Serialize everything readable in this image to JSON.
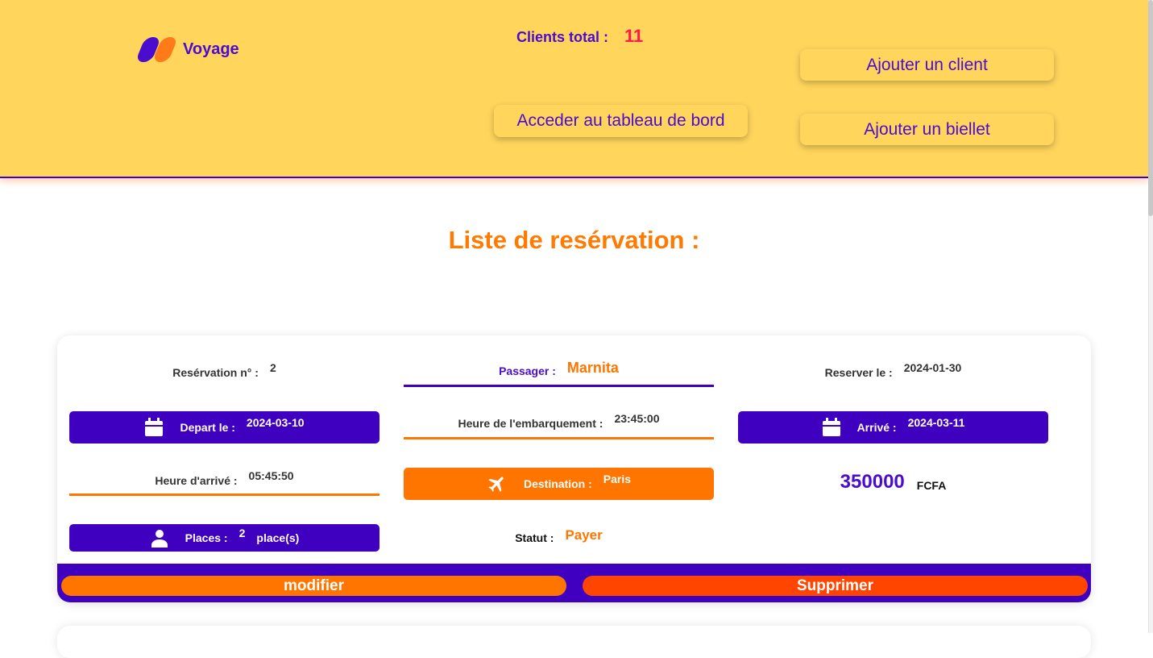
{
  "header": {
    "logo_text": "Voyage",
    "clients_label": "Clients total :",
    "clients_count": "11",
    "add_client_label": "Ajouter un client",
    "dashboard_label": "Acceder au tableau de bord",
    "add_ticket_label": "Ajouter un biellet"
  },
  "page_title": "Liste de resérvation :",
  "reservation": {
    "number_label": "Resérvation n° :",
    "number": "2",
    "passenger_label": "Passager :",
    "passenger": "Marnita",
    "booked_label": "Reserver le :",
    "booked_date": "2024-01-30",
    "departure_label": "Depart le :",
    "departure_date": "2024-03-10",
    "boarding_label": "Heure de l'embarquement :",
    "boarding_time": "23:45:00",
    "arrival_label": "Arrivé :",
    "arrival_date": "2024-03-11",
    "arrival_time_label": "Heure d'arrivé :",
    "arrival_time": "05:45:50",
    "destination_label": "Destination :",
    "destination": "Paris",
    "price": "350000",
    "currency": "FCFA",
    "places_label": "Places :",
    "places": "2",
    "places_unit": "place(s)",
    "status_label": "Statut :",
    "status": "Payer",
    "modify_label": "modifier",
    "delete_label": "Supprimer"
  },
  "icons": {
    "calendar": "calendar-icon",
    "plane": "airplane-icon",
    "user": "user-icon"
  },
  "colors": {
    "header_bg": "#ffd55c",
    "purple": "#4000c0",
    "orange": "#ff7500",
    "red_orange": "#ff4500",
    "pink_count": "#ff1a4a"
  }
}
